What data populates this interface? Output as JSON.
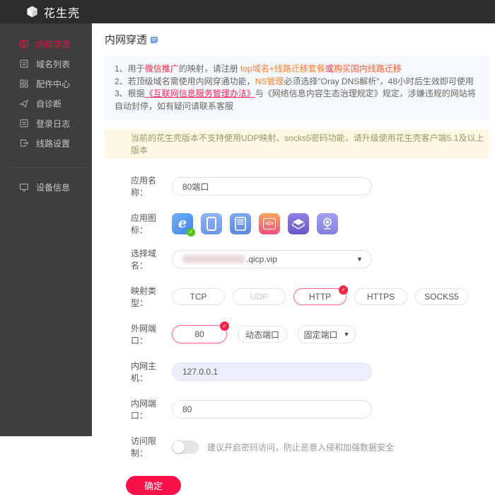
{
  "topbar": {
    "brand": "花生壳"
  },
  "sidebar": {
    "items": [
      {
        "label": "内网穿透",
        "active": true
      },
      {
        "label": "域名列表"
      },
      {
        "label": "配件中心"
      },
      {
        "label": "自诊断"
      },
      {
        "label": "登录日志"
      },
      {
        "label": "线路设置"
      },
      {
        "label": "设备信息"
      }
    ]
  },
  "page": {
    "title": "内网穿透",
    "notice_lines": [
      {
        "segments": [
          {
            "t": "1、用于"
          },
          {
            "t": "微信推广"
          },
          {
            "t": "的映射，请注册 "
          },
          {
            "t": "top域名+线路迁移套餐"
          },
          {
            "t": "或"
          },
          {
            "t": "购买国内线路迁移"
          }
        ]
      },
      {
        "segments": [
          {
            "t": "2、若顶级域名需使用内网穿通功能，"
          },
          {
            "t": "NS管理"
          },
          {
            "t": "必须选择\"Oray DNS解析\"，48小时后生效即可使用"
          }
        ]
      },
      {
        "segments": [
          {
            "t": "3、根据"
          },
          {
            "t": "《互联网信息服务管理办法》"
          },
          {
            "t": "与《网络信息内容生态治理规定》规定，涉嫌违规的网站将自动封停，如有疑问请联系客服"
          }
        ]
      }
    ],
    "warning": "当前的花生壳版本不支持使用UDP映射、socks5密码功能，请升级使用花生壳客户端5.1及以上版本"
  },
  "form": {
    "app_name": {
      "label": "应用名称：",
      "value": "80端口"
    },
    "app_icon": {
      "label": "应用图标：",
      "icons": [
        {
          "name": "ie-browser",
          "selected": true
        },
        {
          "name": "tablet"
        },
        {
          "name": "nas"
        },
        {
          "name": "code-window"
        },
        {
          "name": "router"
        },
        {
          "name": "camera"
        }
      ]
    },
    "domain": {
      "label": "选择域名：",
      "redacted": true,
      "suffix": ".qicp.vip"
    },
    "mapping_type": {
      "label": "映射类型：",
      "options": [
        {
          "label": "TCP"
        },
        {
          "label": "UDP",
          "disabled": true
        },
        {
          "label": "HTTP",
          "selected": true
        },
        {
          "label": "HTTPS"
        },
        {
          "label": "SOCKS5"
        }
      ]
    },
    "external_port": {
      "label": "外网端口：",
      "value": "80",
      "dynamic_button": "动态端口",
      "mode_select": "固定端口"
    },
    "internal_host": {
      "label": "内网主机：",
      "value": "127.0.0.1"
    },
    "internal_port": {
      "label": "内网端口：",
      "value": "80"
    },
    "access_limit": {
      "label": "访问限制：",
      "toggle_on": false,
      "hint": "建议开启密码访问，防止恶意入侵和加强数据安全"
    },
    "submit_label": "确定"
  },
  "colors": {
    "topbar_bg": "#2c2c2c",
    "sidebar_bg": "#3e3e3e",
    "accent_red": "#fa1148",
    "active_item_red": "#e11543",
    "notice_bg": "#f6f9fc",
    "warn_bg": "#fdf8e3",
    "warn_text": "#9b9668",
    "text_red": "#f5223d",
    "text_orange": "#ff7e2e",
    "link_red": "#f5265c",
    "selected_border": "#f8618a",
    "host_input_bg": "#eaeffb"
  }
}
